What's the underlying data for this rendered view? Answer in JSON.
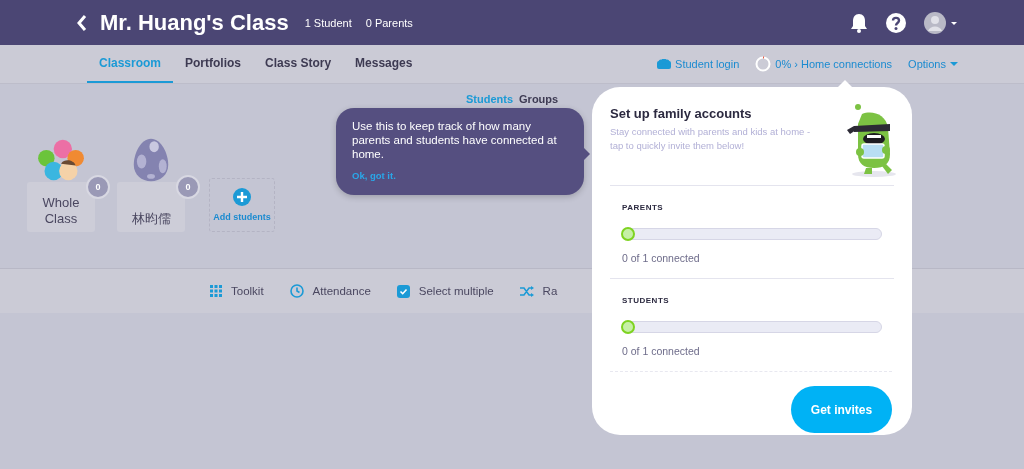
{
  "header": {
    "title": "Mr. Huang's Class",
    "student_count": "1 Student",
    "parent_count": "0 Parents"
  },
  "tabs": [
    {
      "label": "Classroom",
      "selected": true
    },
    {
      "label": "Portfolios",
      "selected": false
    },
    {
      "label": "Class Story",
      "selected": false
    },
    {
      "label": "Messages",
      "selected": false
    }
  ],
  "nav_links": {
    "student_login": "Student login",
    "home_connections": "0% › Home connections",
    "options": "Options"
  },
  "view_toggle": [
    {
      "label": "Students",
      "selected": true
    },
    {
      "label": "Groups",
      "selected": false
    }
  ],
  "students": [
    {
      "kind": "group",
      "name": "Whole Class",
      "points": "0"
    },
    {
      "kind": "egg",
      "name": "林昀儒",
      "points": "0"
    }
  ],
  "add_students": "Add students",
  "tooltip": {
    "text": "Use this to keep track of how many parents and students have connected at home.",
    "action": "Ok, got it."
  },
  "toolbar": [
    {
      "kind": "toolkit",
      "label": "Toolkit"
    },
    {
      "kind": "attendance",
      "label": "Attendance"
    },
    {
      "kind": "select",
      "label": "Select multiple"
    },
    {
      "kind": "random",
      "label": "Ra"
    }
  ],
  "popover": {
    "title": "Set up family accounts",
    "subtitle": "Stay connected with parents and kids at home - tap to quickly invite them below!",
    "sections": [
      {
        "label": "PARENTS",
        "level": 0,
        "reading": "0 of 1 connected"
      },
      {
        "label": "STUDENTS",
        "level": 0,
        "reading": "0 of 1 connected"
      }
    ],
    "button": "Get invites"
  }
}
